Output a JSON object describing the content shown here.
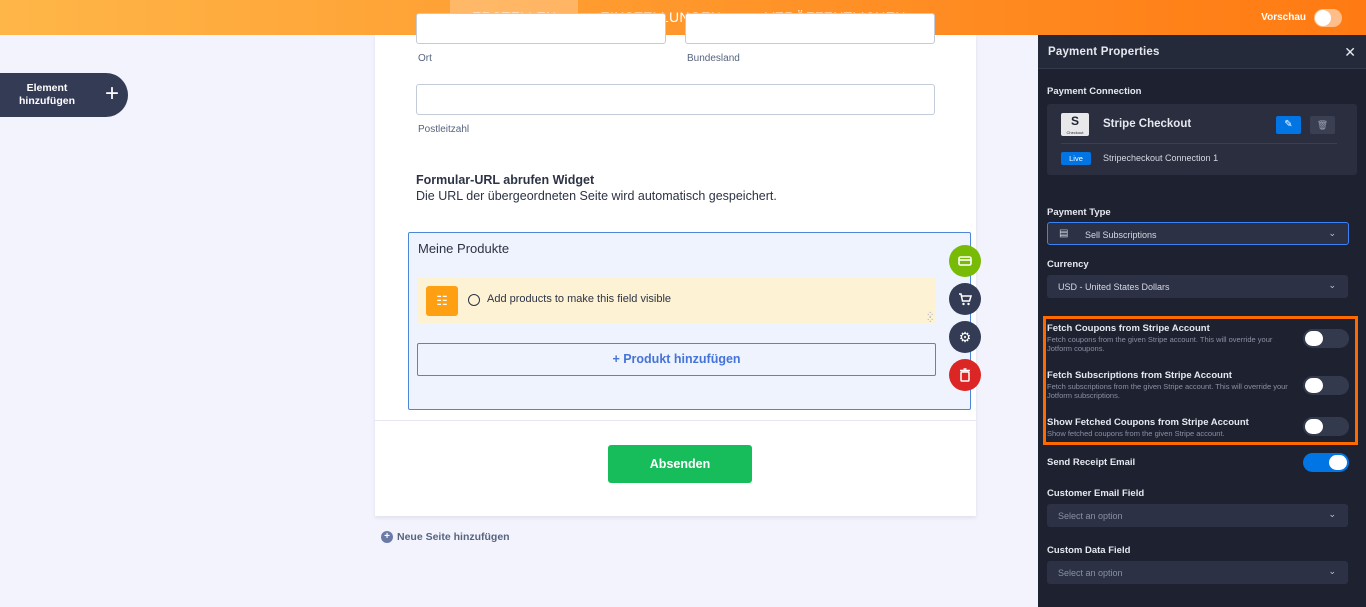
{
  "topnav": {
    "tabs": [
      "ERSTELLEN",
      "EINSTELLUNGEN",
      "VERÖFFENTLICHEN"
    ],
    "preview_label": "Vorschau"
  },
  "add_element": {
    "label": "Element hinzufügen"
  },
  "form": {
    "fields": {
      "city_label": "Ort",
      "state_label": "Bundesland",
      "zip_label": "Postleitzahl"
    },
    "widget": {
      "title": "Formular-URL abrufen Widget",
      "description": "Die URL der übergeordneten Seite wird automatisch gespeichert."
    },
    "products": {
      "title": "Meine Produkte",
      "notice": "Add products to make this field visible",
      "add_button": "+ Produkt hinzufügen"
    },
    "submit_label": "Absenden",
    "new_page_label": "Neue Seite hinzufügen"
  },
  "panel": {
    "title": "Payment Properties",
    "connection": {
      "section_title": "Payment Connection",
      "name": "Stripe Checkout",
      "logo_letter": "S",
      "logo_caption": "Checkout",
      "badge": "Live",
      "connection_name": "Stripecheckout Connection 1"
    },
    "payment_type": {
      "label": "Payment Type",
      "value": "Sell Subscriptions"
    },
    "currency": {
      "label": "Currency",
      "value": "USD - United States Dollars"
    },
    "options": [
      {
        "title": "Fetch Coupons from Stripe Account",
        "description": "Fetch coupons from the given Stripe account. This will override your Jotform coupons.",
        "enabled": false
      },
      {
        "title": "Fetch Subscriptions from Stripe Account",
        "description": "Fetch subscriptions from the given Stripe account. This will override your Jotform subscriptions.",
        "enabled": false
      },
      {
        "title": "Show Fetched Coupons from Stripe Account",
        "description": "Show fetched coupons from the given Stripe account.",
        "enabled": false
      }
    ],
    "send_receipt": {
      "label": "Send Receipt Email",
      "enabled": true
    },
    "customer_email": {
      "label": "Customer Email Field",
      "placeholder": "Select an option"
    },
    "custom_data": {
      "label": "Custom Data Field",
      "placeholder": "Select an option"
    }
  },
  "colors": {
    "topbar_accent": "#ff7a12",
    "panel_bg": "#1e2130",
    "highlight_border": "#ff6a00",
    "submit_green": "#18bd5b",
    "primary_blue": "#0075e3"
  },
  "icons": {
    "tools": [
      "card-icon",
      "cart-icon",
      "gear-icon",
      "trash-icon"
    ]
  }
}
